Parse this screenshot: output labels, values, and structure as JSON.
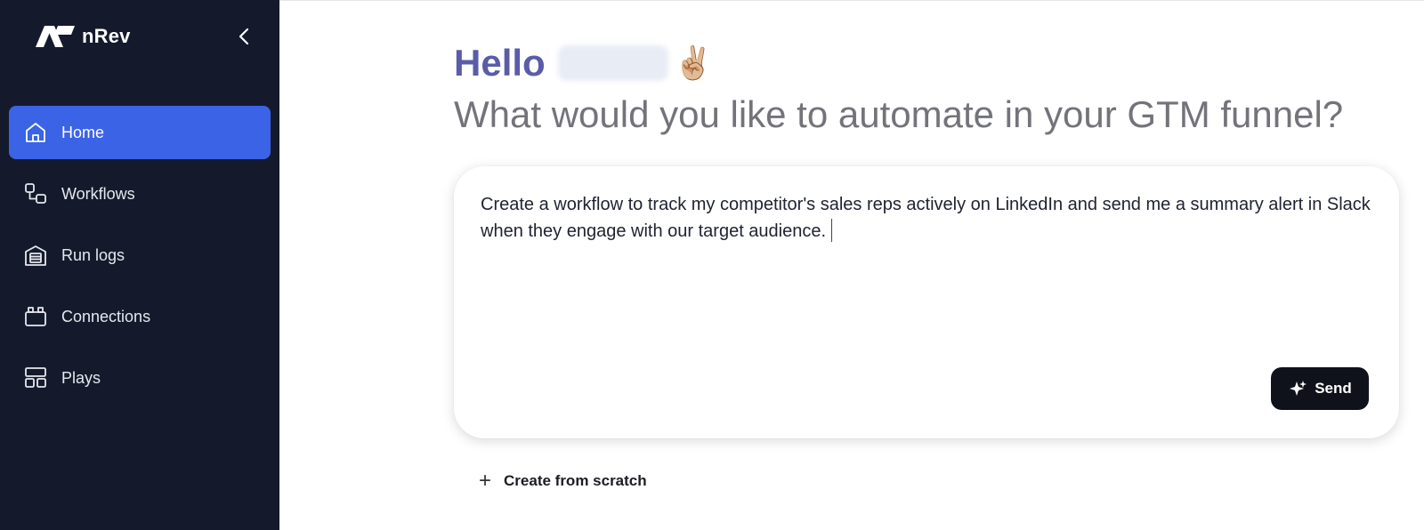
{
  "brand": {
    "name": "nRev"
  },
  "sidebar": {
    "items": [
      {
        "label": "Home",
        "icon": "home-icon",
        "active": true
      },
      {
        "label": "Workflows",
        "icon": "workflows-icon",
        "active": false
      },
      {
        "label": "Run logs",
        "icon": "run-logs-icon",
        "active": false
      },
      {
        "label": "Connections",
        "icon": "connections-icon",
        "active": false
      },
      {
        "label": "Plays",
        "icon": "plays-icon",
        "active": false
      }
    ]
  },
  "main": {
    "greeting": "Hello",
    "emoji": "✌🏼",
    "subtitle": "What would you like to automate in your GTM funnel?",
    "prompt": {
      "value": "Create a workflow to track my competitor's sales reps actively on LinkedIn and send me a summary alert in Slack when they engage with our target audience."
    },
    "send_label": "Send",
    "create_from_scratch": "Create from scratch"
  },
  "colors": {
    "sidebar_bg": "#141a2c",
    "active_item": "#3b63e6",
    "greeting": "#5b5ca8",
    "send_button": "#0f121a"
  }
}
